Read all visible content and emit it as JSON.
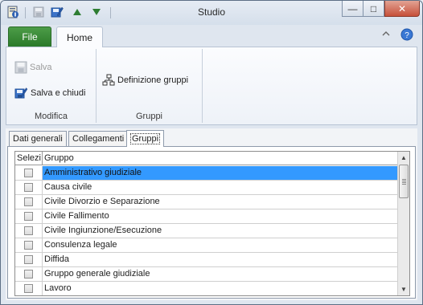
{
  "window": {
    "title": "Studio",
    "minimize_glyph": "—",
    "maximize_glyph": "□",
    "close_glyph": "✕"
  },
  "tabs": {
    "file": "File",
    "home": "Home"
  },
  "ribbon": {
    "groups": [
      {
        "label": "Modifica",
        "buttons": [
          {
            "label": "Salva",
            "icon": "save-icon",
            "enabled": false
          },
          {
            "label": "Salva e chiudi",
            "icon": "save-close-icon",
            "enabled": true
          }
        ]
      },
      {
        "label": "Gruppi",
        "buttons": [
          {
            "label": "Definizione gruppi",
            "icon": "groups-definition-icon",
            "enabled": true
          }
        ]
      }
    ]
  },
  "content_tabs": [
    {
      "label": "Dati generali",
      "active": false
    },
    {
      "label": "Collegamenti",
      "active": false
    },
    {
      "label": "Gruppi",
      "active": true
    }
  ],
  "grid": {
    "columns": [
      "Selezi",
      "Gruppo"
    ],
    "rows": [
      {
        "name": "Amministrativo giudiziale",
        "selected": true,
        "checked": false
      },
      {
        "name": "Causa civile",
        "selected": false,
        "checked": false
      },
      {
        "name": "Civile Divorzio e Separazione",
        "selected": false,
        "checked": false
      },
      {
        "name": "Civile Fallimento",
        "selected": false,
        "checked": false
      },
      {
        "name": "Civile Ingiunzione/Esecuzione",
        "selected": false,
        "checked": false
      },
      {
        "name": "Consulenza legale",
        "selected": false,
        "checked": false
      },
      {
        "name": "Diffida",
        "selected": false,
        "checked": false
      },
      {
        "name": "Gruppo generale giudiziale",
        "selected": false,
        "checked": false
      },
      {
        "name": "Lavoro",
        "selected": false,
        "checked": false
      }
    ]
  },
  "colors": {
    "accent_file_tab": "#2b7a29",
    "selection": "#3399ff",
    "close_button": "#c7503a"
  }
}
